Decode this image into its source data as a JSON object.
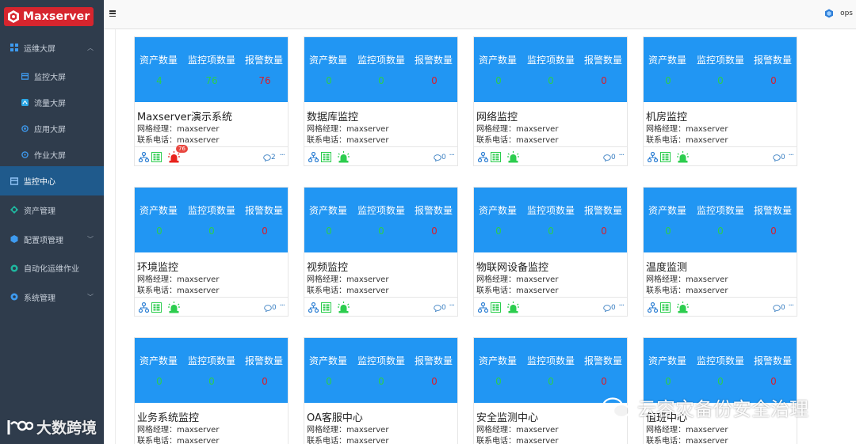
{
  "app": {
    "logo_text": "Maxserver",
    "brand_color": "#d6252e"
  },
  "sidebar": {
    "items": [
      {
        "label": "运维大屏",
        "icon": "grid-icon",
        "expanded": true
      },
      {
        "label": "监控大屏",
        "icon": "monitor-icon"
      },
      {
        "label": "流量大屏",
        "icon": "traffic-icon"
      },
      {
        "label": "应用大屏",
        "icon": "app-icon"
      },
      {
        "label": "作业大屏",
        "icon": "job-icon"
      },
      {
        "label": "监控中心",
        "icon": "monitor-center-icon",
        "active": true
      },
      {
        "label": "资产管理",
        "icon": "asset-icon"
      },
      {
        "label": "配置项管理",
        "icon": "config-icon"
      },
      {
        "label": "自动化运维作业",
        "icon": "automation-icon"
      },
      {
        "label": "系统管理",
        "icon": "settings-icon"
      }
    ]
  },
  "topbar": {
    "user": "ops"
  },
  "stat_labels": {
    "assets": "资产数量",
    "items": "监控项数量",
    "alarms": "报警数量"
  },
  "field_labels": {
    "manager": "网格经理：",
    "phone": "联系电话："
  },
  "cards": [
    {
      "title": "Maxserver演示系统",
      "assets": "4",
      "items": "76",
      "alarms": "76",
      "manager": "maxserver",
      "phone": "maxserver",
      "comments": "2",
      "alarm_badge": "76"
    },
    {
      "title": "数据库监控",
      "assets": "0",
      "items": "0",
      "alarms": "0",
      "manager": "maxserver",
      "phone": "maxserver",
      "comments": "0"
    },
    {
      "title": "网络监控",
      "assets": "0",
      "items": "0",
      "alarms": "0",
      "manager": "maxserver",
      "phone": "maxserver",
      "comments": "0"
    },
    {
      "title": "机房监控",
      "assets": "0",
      "items": "0",
      "alarms": "0",
      "manager": "maxserver",
      "phone": "maxserver",
      "comments": "0"
    },
    {
      "title": "环境监控",
      "assets": "0",
      "items": "0",
      "alarms": "0",
      "manager": "maxserver",
      "phone": "maxserver",
      "comments": "0"
    },
    {
      "title": "视频监控",
      "assets": "0",
      "items": "0",
      "alarms": "0",
      "manager": "maxserver",
      "phone": "maxserver",
      "comments": "0"
    },
    {
      "title": "物联网设备监控",
      "assets": "0",
      "items": "0",
      "alarms": "0",
      "manager": "maxserver",
      "phone": "maxserver",
      "comments": "0"
    },
    {
      "title": "温度监测",
      "assets": "0",
      "items": "0",
      "alarms": "0",
      "manager": "maxserver",
      "phone": "maxserver",
      "comments": "0"
    },
    {
      "title": "业务系统监控",
      "assets": "0",
      "items": "0",
      "alarms": "0",
      "manager": "maxserver",
      "phone": "maxserver"
    },
    {
      "title": "OA客服中心",
      "assets": "0",
      "items": "0",
      "alarms": "0",
      "manager": "maxserver",
      "phone": "maxserver"
    },
    {
      "title": "安全监测中心",
      "assets": "0",
      "items": "0",
      "alarms": "0",
      "manager": "maxserver",
      "phone": "maxserver"
    },
    {
      "title": "值班中心",
      "assets": "0",
      "items": "0",
      "alarms": "0",
      "manager": "maxserver",
      "phone": "maxserver"
    }
  ],
  "watermarks": {
    "left": "大数跨境",
    "right": "云容灾备份安全治理"
  },
  "colors": {
    "header_blue": "#2196f3",
    "value_green": "#2ccd4e",
    "value_red": "#d81e2b",
    "alarm_red": "#e8231d",
    "alarm_green": "#2ccd4e",
    "sidebar_bg": "#2f3c4c",
    "sidebar_active": "#1f5a8c"
  }
}
